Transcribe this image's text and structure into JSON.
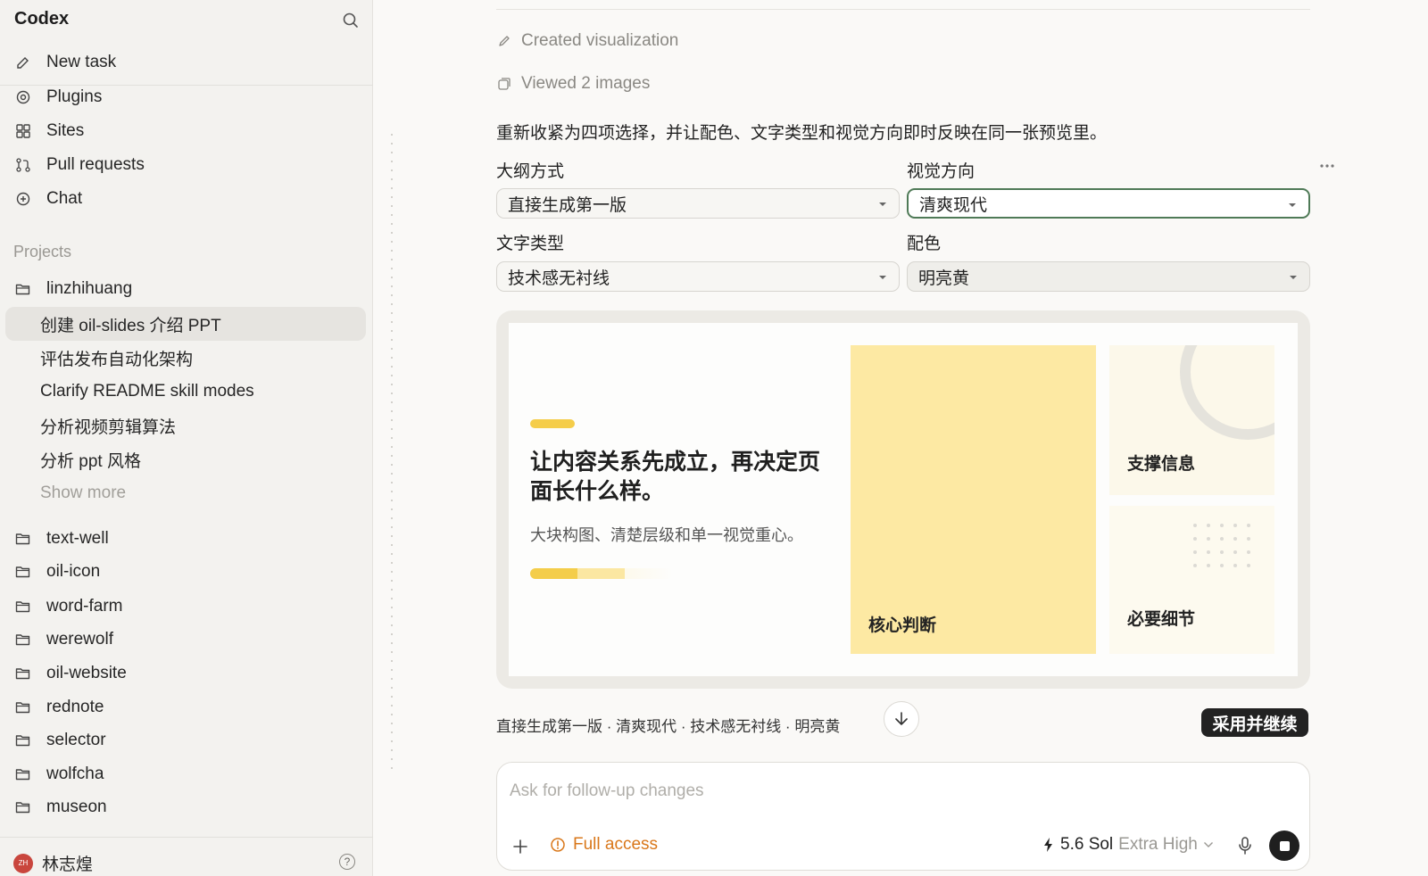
{
  "sidebar": {
    "brand": "Codex",
    "nav": [
      {
        "label": "New task",
        "icon": "edit-icon"
      },
      {
        "label": "Plugins",
        "icon": "plugin-icon"
      },
      {
        "label": "Sites",
        "icon": "sites-icon"
      },
      {
        "label": "Pull requests",
        "icon": "pull-request-icon"
      },
      {
        "label": "Chat",
        "icon": "chat-icon"
      }
    ],
    "projects_label": "Projects",
    "active_project": "linzhihuang",
    "tasks": [
      "创建 oil-slides 介绍 PPT",
      "评估发布自动化架构",
      "Clarify README skill modes",
      "分析视频剪辑算法",
      "分析 ppt 风格"
    ],
    "show_more": "Show more",
    "projects": [
      "text-well",
      "oil-icon",
      "word-farm",
      "werewolf",
      "oil-website",
      "rednote",
      "selector",
      "wolfcha",
      "museon"
    ],
    "user": {
      "initials": "ZH",
      "name": "林志煌"
    },
    "help": "?"
  },
  "main": {
    "activity": [
      "Created visualization",
      "Viewed 2 images"
    ],
    "intro": "重新收紧为四项选择，并让配色、文字类型和视觉方向即时反映在同一张预览里。",
    "fields": {
      "outline": {
        "label": "大纲方式",
        "value": "直接生成第一版"
      },
      "visual": {
        "label": "视觉方向",
        "value": "清爽现代"
      },
      "typeface": {
        "label": "文字类型",
        "value": "技术感无衬线"
      },
      "palette": {
        "label": "配色",
        "value": "明亮黄"
      }
    },
    "preview": {
      "headline": "让内容关系先成立，再决定页面长什么样。",
      "subtitle": "大块构图、清楚层级和单一视觉重心。",
      "core_label": "核心判断",
      "support_label": "支撑信息",
      "detail_label": "必要细节"
    },
    "summary": "直接生成第一版 · 清爽现代 · 技术感无衬线 · 明亮黄",
    "adopt_button": "采用并继续",
    "composer": {
      "placeholder": "Ask for follow-up changes",
      "access_label": "Full access",
      "model_name": "5.6 Sol",
      "effort": "Extra High"
    },
    "colors": {
      "accent_yellow": "#f5cd4a",
      "card_yellow": "#fde9a3",
      "focus_green": "#4f7a57",
      "access_orange": "#d9771a"
    }
  }
}
